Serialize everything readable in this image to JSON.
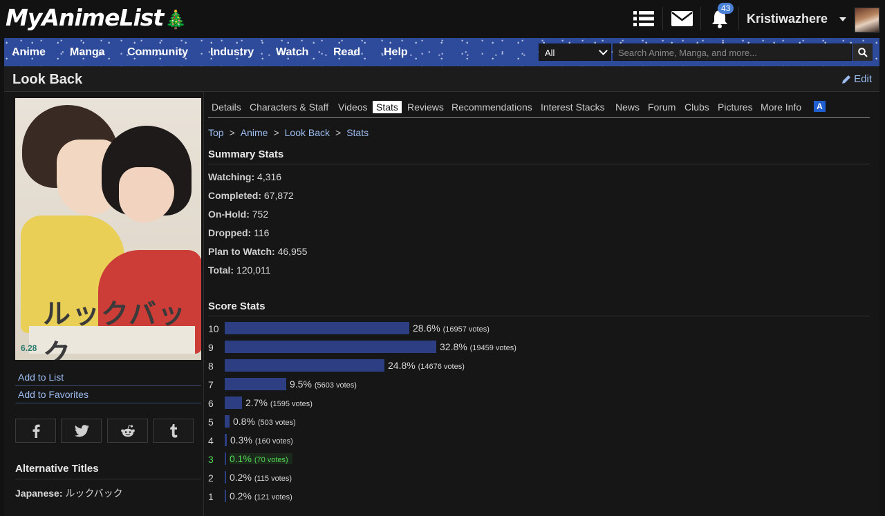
{
  "header": {
    "logo_text": "MyAnimeList",
    "logo_tree": "🎄",
    "notification_count": "43",
    "username": "Kristiwazhere"
  },
  "nav": {
    "items": [
      "Anime",
      "Manga",
      "Community",
      "Industry",
      "Watch",
      "Read",
      "Help"
    ],
    "search_category": "All",
    "search_placeholder": "Search Anime, Manga, and more..."
  },
  "page": {
    "title": "Look Back",
    "edit_label": "Edit"
  },
  "sidebar": {
    "poster": {
      "title_art": "ルックバック",
      "date": "6.28"
    },
    "links": [
      "Add to List",
      "Add to Favorites"
    ],
    "share_icons": [
      "facebook-icon",
      "twitter-icon",
      "reddit-icon",
      "tumblr-icon"
    ],
    "alt_titles_heading": "Alternative Titles",
    "japanese_label": "Japanese:",
    "japanese_value": "ルックバック"
  },
  "tabs": [
    "Details",
    "Characters & Staff",
    "Videos",
    "Stats",
    "Reviews",
    "Recommendations",
    "Interest Stacks",
    "News",
    "Forum",
    "Clubs",
    "Pictures",
    "More Info"
  ],
  "active_tab": "Stats",
  "breadcrumb": [
    "Top",
    "Anime",
    "Look Back",
    "Stats"
  ],
  "summary": {
    "heading": "Summary Stats",
    "rows": [
      {
        "label": "Watching:",
        "value": "4,316"
      },
      {
        "label": "Completed:",
        "value": "67,872"
      },
      {
        "label": "On-Hold:",
        "value": "752"
      },
      {
        "label": "Dropped:",
        "value": "116"
      },
      {
        "label": "Plan to Watch:",
        "value": "46,955"
      },
      {
        "label": "Total:",
        "value": "120,011"
      }
    ]
  },
  "scores": {
    "heading": "Score Stats",
    "user_score": 3,
    "rows": [
      {
        "score": "10",
        "percent": 28.6,
        "percent_label": "28.6%",
        "votes_label": "(16957 votes)"
      },
      {
        "score": "9",
        "percent": 32.8,
        "percent_label": "32.8%",
        "votes_label": "(19459 votes)"
      },
      {
        "score": "8",
        "percent": 24.8,
        "percent_label": "24.8%",
        "votes_label": "(14676 votes)"
      },
      {
        "score": "7",
        "percent": 9.5,
        "percent_label": "9.5%",
        "votes_label": "(5603 votes)"
      },
      {
        "score": "6",
        "percent": 2.7,
        "percent_label": "2.7%",
        "votes_label": "(1595 votes)"
      },
      {
        "score": "5",
        "percent": 0.8,
        "percent_label": "0.8%",
        "votes_label": "(503 votes)"
      },
      {
        "score": "4",
        "percent": 0.3,
        "percent_label": "0.3%",
        "votes_label": "(160 votes)"
      },
      {
        "score": "3",
        "percent": 0.1,
        "percent_label": "0.1%",
        "votes_label": "(70 votes)"
      },
      {
        "score": "2",
        "percent": 0.2,
        "percent_label": "0.2%",
        "votes_label": "(115 votes)"
      },
      {
        "score": "1",
        "percent": 0.2,
        "percent_label": "0.2%",
        "votes_label": "(121 votes)"
      }
    ]
  },
  "colors": {
    "background": "#121212",
    "nav_blue": "#2e4b9b",
    "link": "#9cbcf0",
    "bar": "#2e3e82",
    "user_score_green": "#54d954"
  }
}
